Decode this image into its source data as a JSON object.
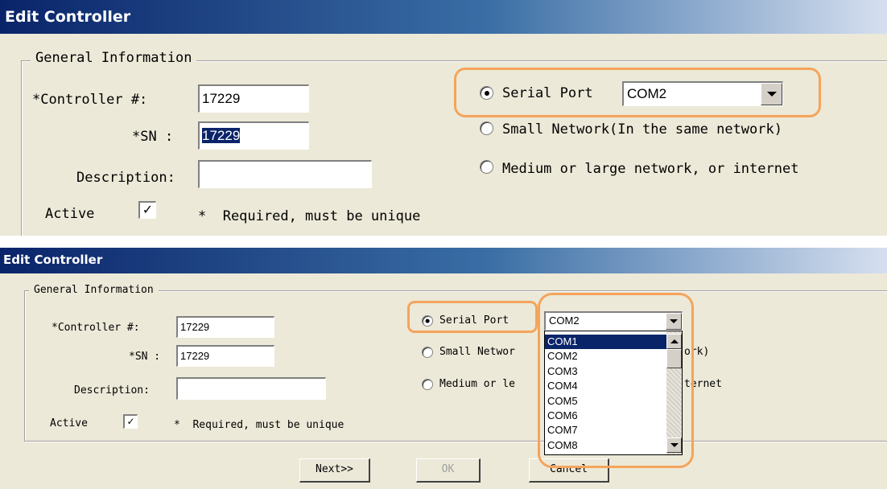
{
  "top": {
    "title": "Edit Controller",
    "group_label": "General Information",
    "controller_label": "*Controller #:",
    "controller_value": "17229",
    "sn_label": "*SN :",
    "sn_value": "17229",
    "description_label": "Description:",
    "description_value": "",
    "active_label": "Active",
    "active_checked": "✓",
    "required_note": "*  Required, must be unique",
    "radio_serial": "Serial Port",
    "combo_value": "COM2",
    "radio_small": "Small Network(In the same network)",
    "radio_medium": "Medium or large network, or internet"
  },
  "bottom": {
    "title": "Edit Controller",
    "group_label": "General Information",
    "controller_label": "*Controller #:",
    "controller_value": "17229",
    "sn_label": "*SN :",
    "sn_value": "17229",
    "description_label": "Description:",
    "description_value": "",
    "active_label": "Active",
    "active_checked": "✓",
    "required_note": "*  Required, must be unique",
    "radio_serial": "Serial Port",
    "combo_value": "COM2",
    "radio_small_visible": "Small Networ",
    "radio_small_tail": "ork)",
    "radio_medium_visible": "Medium or le",
    "radio_medium_tail": "ternet",
    "dropdown_options": [
      "COM1",
      "COM2",
      "COM3",
      "COM4",
      "COM5",
      "COM6",
      "COM7",
      "COM8"
    ],
    "selected_option": "COM1",
    "next_button": "Next>>",
    "ok_button": "OK",
    "cancel_button": "Cancel"
  },
  "colors": {
    "highlight": "#f5a45c",
    "title_bar": "#0a246a",
    "selection": "#0a246a",
    "dialog_bg": "#ece9d8"
  }
}
